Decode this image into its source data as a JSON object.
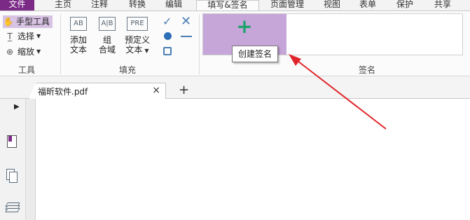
{
  "menubar": {
    "items": [
      "文件",
      "主页",
      "注释",
      "转换",
      "编辑",
      "填写&签名",
      "页面管理",
      "视图",
      "表单",
      "保护",
      "共享"
    ],
    "active": "填写&签名"
  },
  "ribbon": {
    "tools": {
      "hand": "手型工具",
      "select": "选择",
      "zoom": "缩放",
      "group_label": "工具"
    },
    "fill": {
      "add_text": [
        "添加",
        "文本"
      ],
      "combine_field": [
        "组",
        "合域"
      ],
      "predefined_text": [
        "预定义",
        "文本"
      ],
      "group_label": "填充",
      "glyphs": {
        "add_text": "AB",
        "combine_field": "A|B",
        "predefined_text": "PRE"
      }
    },
    "sign": {
      "plus": "+",
      "tooltip": "创建签名",
      "group_label": "签名"
    }
  },
  "tabs": {
    "doc_title": "福昕软件.pdf",
    "close": "×",
    "new_tab": "+"
  },
  "colors": {
    "file_tab": "#7b2a86",
    "highlight": "#c6a5d9",
    "plus": "#1aa36b",
    "arrow": "#e0262b",
    "checkmark": "#4a7fb5"
  }
}
